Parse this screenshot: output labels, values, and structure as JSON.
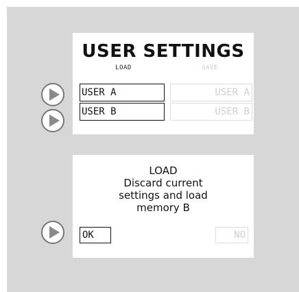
{
  "settings": {
    "title": "USER SETTINGS",
    "load_label": "LOAD",
    "save_label": "SAVE",
    "load_slots": [
      "USER A",
      "USER B"
    ],
    "save_slots": [
      "USER A",
      "USER B"
    ]
  },
  "dialog": {
    "lines": [
      "LOAD",
      "Discard current",
      "settings and load",
      "memory B"
    ],
    "ok_label": "OK",
    "no_label": "NO"
  },
  "icons": {
    "arrow": "play-arrow-icon"
  },
  "colors": {
    "background": "#d7d7d7",
    "panel": "#ffffff",
    "text": "#111111",
    "disabled": "#cfcfcf"
  }
}
